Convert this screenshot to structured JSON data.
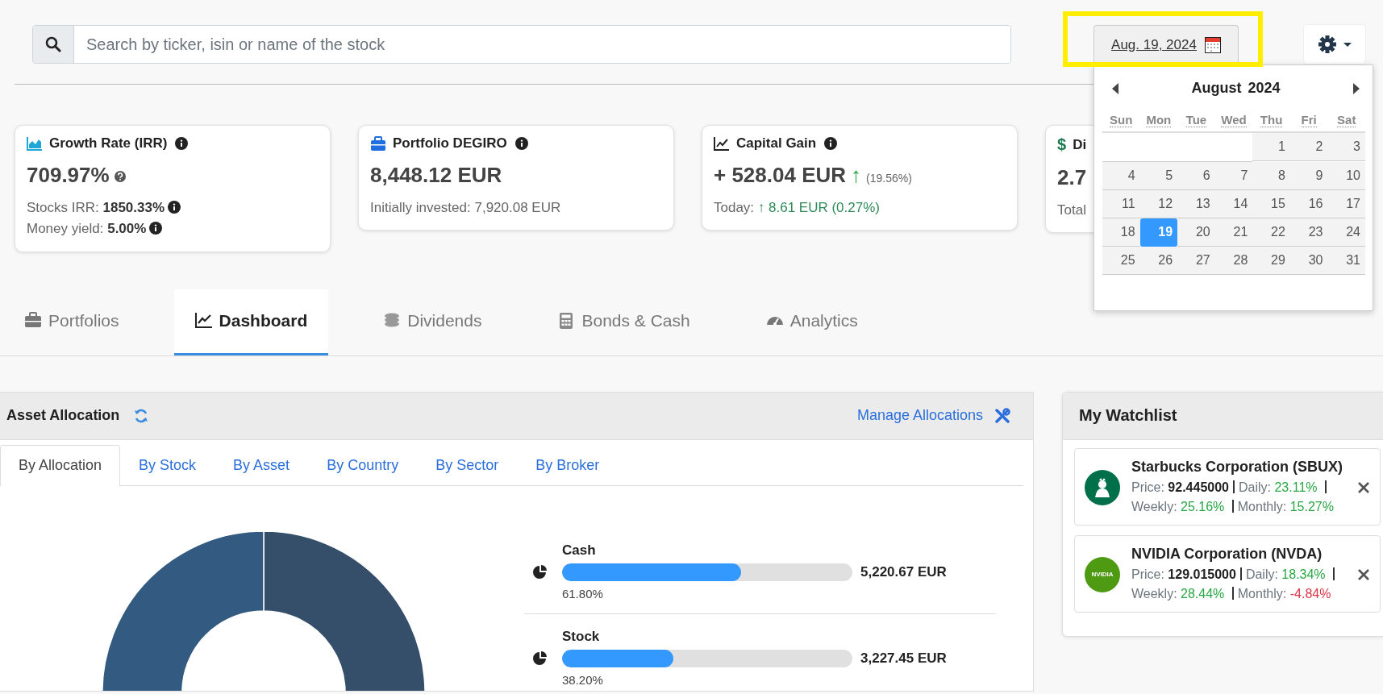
{
  "search": {
    "placeholder": "Search by ticker, isin or name of the stock"
  },
  "date_picker": {
    "value": "Aug. 19, 2024",
    "highlighted": true
  },
  "calendar": {
    "month": "August",
    "year": "2024",
    "weekdays": [
      "Sun",
      "Mon",
      "Tue",
      "Wed",
      "Thu",
      "Fri",
      "Sat"
    ],
    "weeks": [
      [
        {
          "day": "1",
          "selected": false
        },
        {
          "day": "2",
          "selected": false
        },
        {
          "day": "3",
          "selected": false
        }
      ],
      [
        {
          "day": "4",
          "selected": false
        },
        {
          "day": "5",
          "selected": false
        },
        {
          "day": "6",
          "selected": false
        },
        {
          "day": "7",
          "selected": false
        },
        {
          "day": "8",
          "selected": false
        },
        {
          "day": "9",
          "selected": false
        },
        {
          "day": "10",
          "selected": false
        }
      ],
      [
        {
          "day": "11",
          "selected": false
        },
        {
          "day": "12",
          "selected": false
        },
        {
          "day": "13",
          "selected": false
        },
        {
          "day": "14",
          "selected": false
        },
        {
          "day": "15",
          "selected": false
        },
        {
          "day": "16",
          "selected": false
        },
        {
          "day": "17",
          "selected": false
        }
      ],
      [
        {
          "day": "18",
          "selected": false
        },
        {
          "day": "19",
          "selected": true
        },
        {
          "day": "20",
          "selected": false
        },
        {
          "day": "21",
          "selected": false
        },
        {
          "day": "22",
          "selected": false
        },
        {
          "day": "23",
          "selected": false
        },
        {
          "day": "24",
          "selected": false
        }
      ],
      [
        {
          "day": "25",
          "selected": false
        },
        {
          "day": "26",
          "selected": false
        },
        {
          "day": "27",
          "selected": false
        },
        {
          "day": "28",
          "selected": false
        },
        {
          "day": "29",
          "selected": false
        },
        {
          "day": "30",
          "selected": false
        },
        {
          "day": "31",
          "selected": false
        }
      ]
    ]
  },
  "stat_cards": [
    {
      "title": "Growth Rate (IRR)",
      "title_info": true,
      "value": "709.97%",
      "value_help": true,
      "details": [
        {
          "label": "Stocks IRR:",
          "value": "1850.33%",
          "bold": true,
          "info": true
        },
        {
          "label": "Money yield:",
          "value": "5.00%",
          "bold": true,
          "info": true
        }
      ]
    },
    {
      "title": "Portfolio DEGIRO",
      "title_info": true,
      "value": "8,448.12 EUR",
      "value_help": false,
      "details": [
        {
          "label": "Initially invested:",
          "value": "7,920.08 EUR",
          "bold": false,
          "info": false
        }
      ]
    },
    {
      "title": "Capital Gain",
      "title_info": true,
      "value": "+ 528.04 EUR",
      "value_help": false,
      "trend": "↑",
      "change": "(19.56%)",
      "details": [
        {
          "label": "Today:",
          "value": "↑ 8.61 EUR (0.27%)",
          "bold": false,
          "color": "#2e8b57",
          "info": false
        }
      ]
    },
    {
      "icon_glyph": "$",
      "title": "Di",
      "title_info": false,
      "value": "2.7",
      "value_help": false,
      "details": [
        {
          "label": "Total",
          "info": false
        }
      ]
    }
  ],
  "tabs": [
    {
      "label": "Portfolios",
      "selected": false
    },
    {
      "label": "Dashboard",
      "selected": true
    },
    {
      "label": "Dividends",
      "selected": false
    },
    {
      "label": "Bonds & Cash",
      "selected": false
    },
    {
      "label": "Analytics",
      "selected": false
    }
  ],
  "allocation": {
    "title": "Asset Allocation",
    "manage_link": "Manage Allocations",
    "subtabs": [
      {
        "label": "By Allocation",
        "selected": true
      },
      {
        "label": "By Stock",
        "selected": false
      },
      {
        "label": "By Asset",
        "selected": false
      },
      {
        "label": "By Country",
        "selected": false
      },
      {
        "label": "By Sector",
        "selected": false
      },
      {
        "label": "By Broker",
        "selected": false
      }
    ],
    "items": [
      {
        "name": "Cash",
        "level": 0.618,
        "percent": "61.80%",
        "amount": "5,220.67 EUR"
      },
      {
        "name": "Stock",
        "level": 0.382,
        "percent": "38.20%",
        "amount": "3,227.45 EUR"
      }
    ]
  },
  "watchlist": {
    "title": "My Watchlist",
    "items": [
      {
        "name": "Starbucks Corporation (SBUX)",
        "color": "#00704a",
        "price_label": "Price:",
        "price": "92.445000",
        "metrics": [
          {
            "label": "Daily:",
            "value": "23.11%",
            "color": "#28a745"
          },
          {
            "label": "Weekly:",
            "value": "25.16%",
            "color": "#28a745"
          },
          {
            "label": "Monthly:",
            "value": "15.27%",
            "color": "#28a745"
          }
        ]
      },
      {
        "name": "NVIDIA Corporation (NVDA)",
        "color": "#4e9a12",
        "logo_text": "NVIDIA",
        "price_label": "Price:",
        "price": "129.015000",
        "metrics": [
          {
            "label": "Daily:",
            "value": "18.34%",
            "color": "#28a745"
          },
          {
            "label": "Weekly:",
            "value": "28.44%",
            "color": "#28a745"
          },
          {
            "label": "Monthly:",
            "value": "-4.84%",
            "color": "#dc3545"
          }
        ]
      }
    ]
  }
}
